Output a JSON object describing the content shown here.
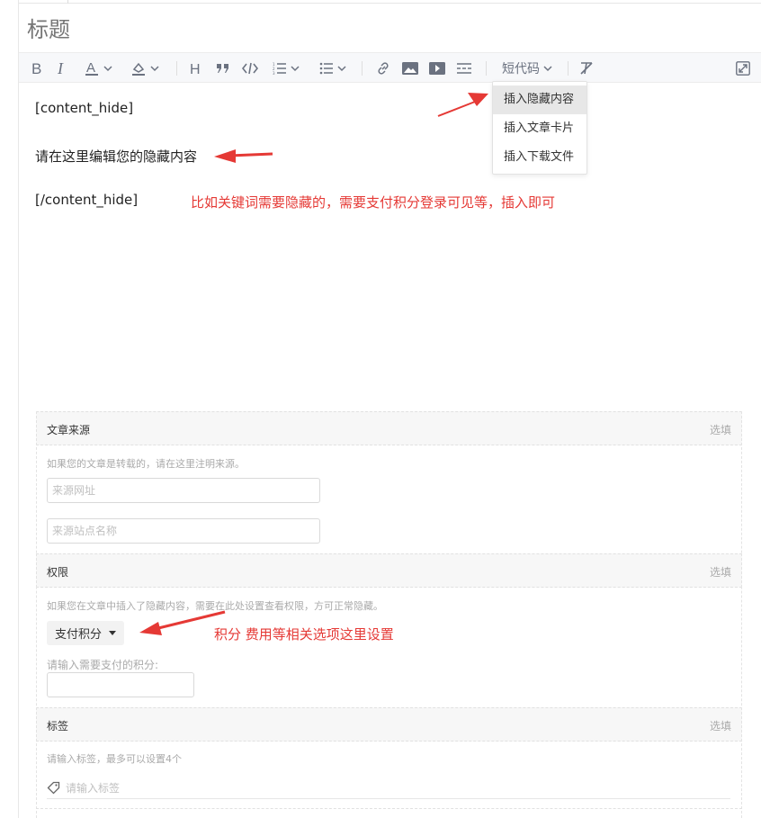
{
  "title": {
    "placeholder": "标题"
  },
  "toolbar": {
    "icons": [
      "bold-icon",
      "italic-icon",
      "font-color-icon",
      "highlight-icon",
      "heading-icon",
      "quote-icon",
      "code-icon",
      "ordered-list-icon",
      "bullet-list-icon",
      "link-icon",
      "image-icon",
      "video-icon",
      "divider-icon",
      "clear-format-icon",
      "fullscreen-icon"
    ],
    "shortcode_label": "短代码"
  },
  "dropdown": {
    "items": [
      "插入隐藏内容",
      "插入文章卡片",
      "插入下载文件"
    ]
  },
  "editor": {
    "line1": "[content_hide]",
    "line2": "请在这里编辑您的隐藏内容",
    "line3": "[/content_hide]"
  },
  "annotations": {
    "note1": "比如关键词需要隐藏的，需要支付积分登录可见等，插入即可",
    "note2": "积分 费用等相关选项这里设置",
    "color": "#e53935"
  },
  "sections": {
    "source": {
      "title": "文章来源",
      "optional": "选填",
      "hint": "如果您的文章是转载的，请在这里注明来源。",
      "url_placeholder": "来源网址",
      "site_placeholder": "来源站点名称"
    },
    "permission": {
      "title": "权限",
      "optional": "选填",
      "hint": "如果您在文章中插入了隐藏内容，需要在此处设置查看权限，方可正常隐藏。",
      "select_value": "支付积分",
      "points_label": "请输入需要支付的积分:"
    },
    "tags": {
      "title": "标签",
      "optional": "选填",
      "hint": "请输入标签，最多可以设置4个",
      "input_placeholder": "请输入标签"
    }
  }
}
